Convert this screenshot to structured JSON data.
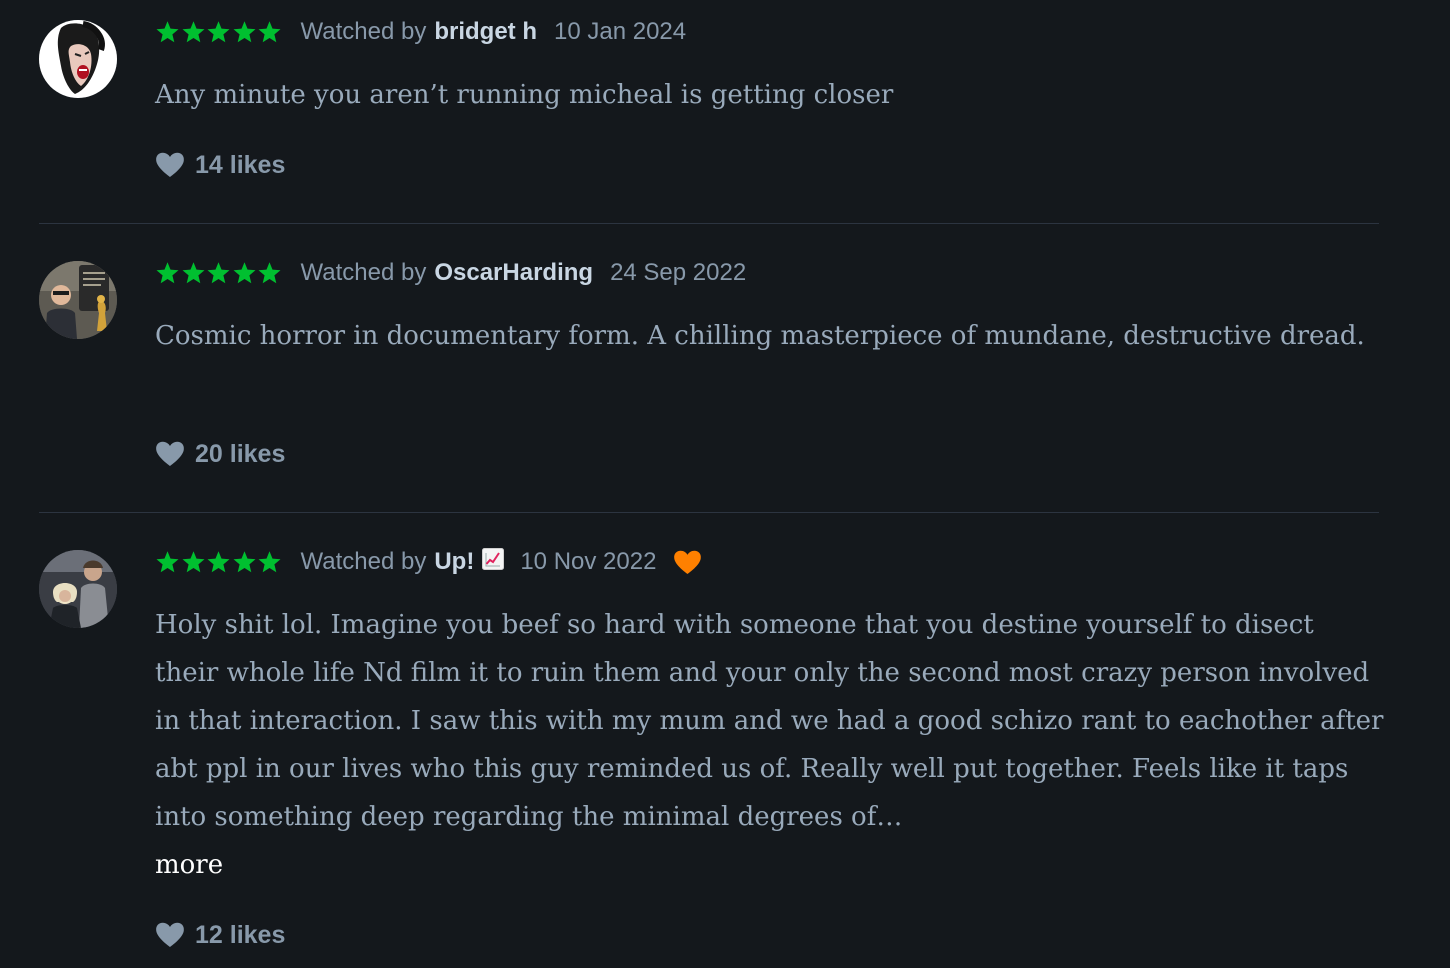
{
  "reviews": [
    {
      "rating_stars": 5,
      "watched_prefix": "Watched by",
      "username": "bridget h",
      "date": "10 Jan 2024",
      "body": "Any minute you aren’t running micheal is getting closer",
      "likes": "14 likes",
      "liked_by_author": false
    },
    {
      "rating_stars": 5,
      "watched_prefix": "Watched by",
      "username": "OscarHarding",
      "date": "24 Sep 2022",
      "body": "Cosmic horror in documentary form. A chilling masterpiece of mundane, destructive dread.",
      "likes": "20 likes",
      "liked_by_author": false
    },
    {
      "rating_stars": 5,
      "watched_prefix": "Watched by",
      "username": "Up!",
      "username_emoji": "📈",
      "date": "10 Nov 2022",
      "body": "Holy shit lol. Imagine you beef so hard with someone that you destine yourself to disect their whole life Nd film it to ruin them and your only the second most crazy person involved in that interaction. I saw this with my mum and we had a good schizo rant to eachother after abt ppl in our lives who this guy reminded us of. Really well put together. Feels like it taps into something deep regarding the minimal degrees of…",
      "more_label": "more",
      "likes": "12 likes",
      "liked_by_author": true
    }
  ],
  "colors": {
    "background": "#14181c",
    "star_green": "#00c030",
    "liked_heart_orange": "#ff8000",
    "muted_text": "#8899aa",
    "username_text": "#c9d6e3",
    "more_link": "#ffffff"
  },
  "icons": {
    "rating": "star-icon",
    "likes": "heart-icon",
    "liked": "liked-heart-icon"
  }
}
